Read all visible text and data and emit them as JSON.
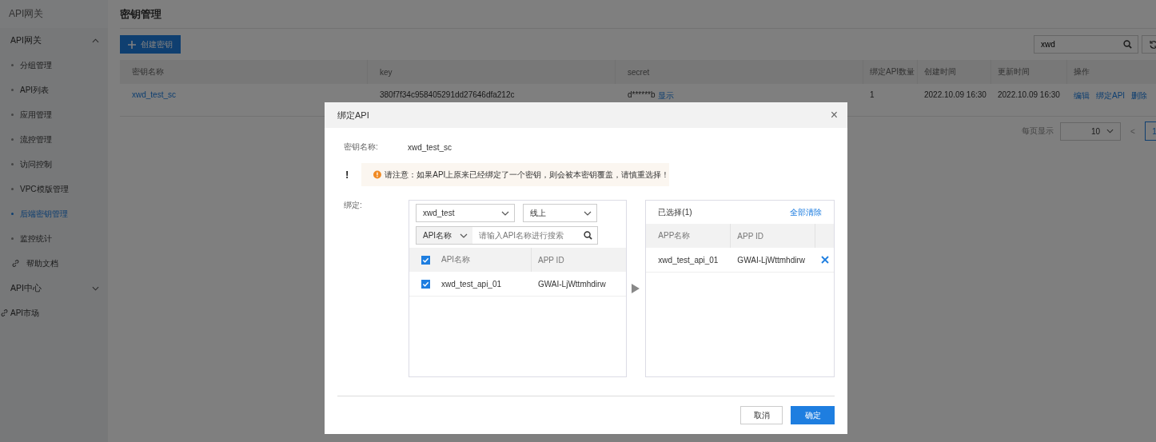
{
  "sidebar": {
    "title": "API网关",
    "sections": [
      {
        "title": "API网关",
        "expanded": true,
        "items": [
          {
            "label": "分组管理",
            "kind": "bullet",
            "selected": false
          },
          {
            "label": "API列表",
            "kind": "bullet",
            "selected": false
          },
          {
            "label": "应用管理",
            "kind": "bullet",
            "selected": false
          },
          {
            "label": "流控管理",
            "kind": "bullet",
            "selected": false
          },
          {
            "label": "访问控制",
            "kind": "bullet",
            "selected": false
          },
          {
            "label": "VPC模版管理",
            "kind": "bullet",
            "selected": false
          },
          {
            "label": "后端密钥管理",
            "kind": "bullet",
            "selected": true
          },
          {
            "label": "监控统计",
            "kind": "bullet",
            "selected": false
          },
          {
            "label": "帮助文档",
            "kind": "link",
            "selected": false
          }
        ]
      },
      {
        "title": "API中心",
        "expanded": false
      }
    ],
    "links": [
      "API市场"
    ]
  },
  "page": {
    "title": "密钥管理",
    "create_button": "创建密钥",
    "search": {
      "value": "xwd"
    },
    "table": {
      "columns": [
        "密钥名称",
        "key",
        "secret",
        "绑定API数量",
        "创建时间",
        "更新时间",
        "操作"
      ],
      "rows": [
        {
          "name": "xwd_test_sc",
          "key": "380f7f34c958405291dd27646dfa212c",
          "secret": "d******b",
          "secret_action": "显示",
          "count": "1",
          "created": "2022.10.09 16:30",
          "updated": "2022.10.09 16:30",
          "actions": [
            "编辑",
            "绑定API",
            "删除"
          ]
        }
      ]
    },
    "pagination": {
      "label": "每页显示",
      "page_size": "10",
      "prev": "<",
      "pages": [
        {
          "label": "1",
          "selected": true
        }
      ]
    }
  },
  "dialog": {
    "title": "绑定API",
    "close": "×",
    "key_label": "密钥名称:",
    "key_value": "xwd_test_sc",
    "notice_mark": "!",
    "notice": "请注意：如果API上原来已经绑定了一个密钥，则会被本密钥覆盖，请慎重选择！",
    "bind_label": "绑定:",
    "source": {
      "group_select": "xwd_test",
      "env_select": "线上",
      "search_type": "API名称",
      "search_placeholder": "请输入API名称进行搜索",
      "columns": [
        "API名称",
        "APP ID"
      ],
      "all_checked": true,
      "rows": [
        {
          "name": "xwd_test_api_01",
          "app_id": "GWAI-LjWttmhdirw",
          "checked": true
        }
      ]
    },
    "target": {
      "title": "已选择(1)",
      "clear": "全部清除",
      "columns": [
        "APP名称",
        "APP ID"
      ],
      "rows": [
        {
          "name": "xwd_test_api_01",
          "app_id": "GWAI-LjWttmhdirw"
        }
      ]
    },
    "buttons": [
      {
        "label": "取消",
        "kind": "secondary"
      },
      {
        "label": "确定",
        "kind": "primary"
      }
    ]
  }
}
